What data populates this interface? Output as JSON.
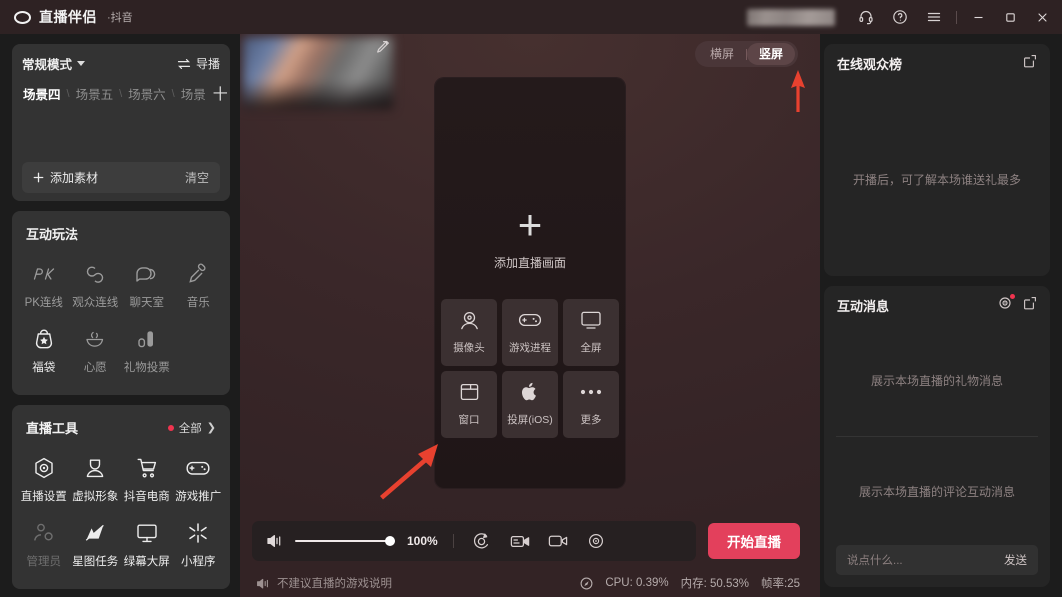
{
  "titlebar": {
    "brand": "直播伴侣",
    "brand_sub": "·抖音",
    "icons": [
      "headset-icon",
      "help-icon",
      "menu-icon"
    ],
    "window_controls": [
      "minimize",
      "maximize",
      "close"
    ]
  },
  "scenes": {
    "mode_label": "常规模式",
    "director_label": "导播",
    "tabs": [
      {
        "label": "场景四",
        "active": true
      },
      {
        "label": "场景五",
        "active": false
      },
      {
        "label": "场景六",
        "active": false
      },
      {
        "label": "场景",
        "active": false
      }
    ],
    "add_tab": "十",
    "add_material": "添加素材",
    "clear": "清空"
  },
  "interactive": {
    "title": "互动玩法",
    "items": [
      {
        "label": "PK连线",
        "icon": "pk-icon",
        "state": "normal"
      },
      {
        "label": "观众连线",
        "icon": "link-icon",
        "state": "normal"
      },
      {
        "label": "聊天室",
        "icon": "chat-icon",
        "state": "normal"
      },
      {
        "label": "音乐",
        "icon": "microphone-icon",
        "state": "normal"
      },
      {
        "label": "福袋",
        "icon": "lucky-bag-icon",
        "state": "bright"
      },
      {
        "label": "心愿",
        "icon": "wish-icon",
        "state": "normal"
      },
      {
        "label": "礼物投票",
        "icon": "gift-vote-icon",
        "state": "normal"
      }
    ]
  },
  "tools": {
    "title": "直播工具",
    "all_label": "全部",
    "items": [
      {
        "label": "直播设置",
        "icon": "settings-hex-icon",
        "state": "bright"
      },
      {
        "label": "虚拟形象",
        "icon": "avatar-icon",
        "state": "bright"
      },
      {
        "label": "抖音电商",
        "icon": "cart-icon",
        "state": "bright"
      },
      {
        "label": "游戏推广",
        "icon": "gamepad-icon",
        "state": "bright"
      },
      {
        "label": "管理员",
        "icon": "admin-icon",
        "state": "dim"
      },
      {
        "label": "星图任务",
        "icon": "star-task-icon",
        "state": "bright"
      },
      {
        "label": "绿幕大屏",
        "icon": "monitor-icon",
        "state": "bright"
      },
      {
        "label": "小程序",
        "icon": "miniapp-icon",
        "state": "bright"
      }
    ]
  },
  "orientation": {
    "landscape": "横屏",
    "portrait": "竖屏",
    "selected": "竖屏"
  },
  "preview": {
    "plus_glyph": "+",
    "add_label": "添加直播画面",
    "sources": [
      {
        "label": "摄像头",
        "icon": "camera-icon"
      },
      {
        "label": "游戏进程",
        "icon": "gamepad-icon"
      },
      {
        "label": "全屏",
        "icon": "fullscreen-monitor-icon"
      },
      {
        "label": "窗口",
        "icon": "window-icon"
      },
      {
        "label": "投屏(iOS)",
        "icon": "apple-icon"
      },
      {
        "label": "更多",
        "icon": "more-dots-icon"
      }
    ]
  },
  "controls": {
    "volume_percent": "100%",
    "icons": [
      "beauty-icon",
      "screen-share-icon",
      "camera-toggle-icon",
      "settings-gear-icon"
    ],
    "go_live": "开始直播"
  },
  "status": {
    "warning": "不建议直播的游戏说明",
    "cpu": "CPU: 0.39%",
    "memory": "内存: 50.53%",
    "fps": "帧率:25"
  },
  "audience_panel": {
    "title": "在线观众榜",
    "empty_text": "开播后，可了解本场谁送礼最多",
    "popout_icon": "popout-icon"
  },
  "message_panel": {
    "title": "互动消息",
    "gift_placeholder": "展示本场直播的礼物消息",
    "chat_placeholder": "展示本场直播的评论互动消息",
    "input_placeholder": "说点什么...",
    "send_label": "发送",
    "icons": [
      "settings-gear-icon",
      "popout-icon"
    ]
  },
  "colors": {
    "accent_red": "#e3405c",
    "badge_red": "#f0344f",
    "panel_dark": "#333333",
    "stage_maroon": "#3a2729"
  }
}
